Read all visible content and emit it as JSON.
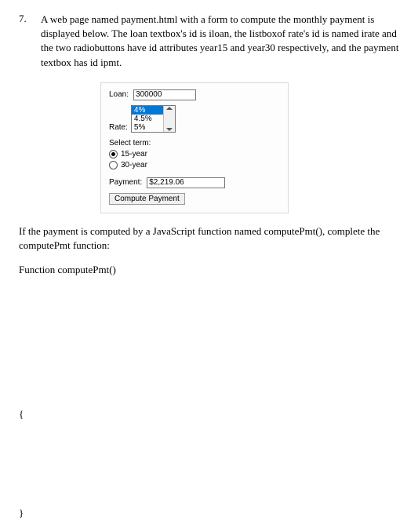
{
  "question": {
    "number": "7.",
    "text": "A web page named payment.html with a form to compute the monthly payment is displayed below.  The loan textbox's id is iloan, the listboxof rate's id is named irate and the two radiobuttons have id attributes year15 and year30 respectively, and the payment textbox has id ipmt."
  },
  "form": {
    "loan_label": "Loan:",
    "loan_value": "300000",
    "rate_label": "Rate:",
    "rate_options": [
      "4%",
      "4.5%",
      "5%"
    ],
    "select_term_label": "Select term:",
    "term15_label": "15-year",
    "term30_label": "30-year",
    "payment_label": "Payment:",
    "payment_value": "$2,219.06",
    "button_label": "Compute Payment"
  },
  "follow_text": "If the payment is computed by a JavaScript function named computePmt(), complete the computePmt function:",
  "fn_header": "Function computePmt()",
  "brace_open": "{",
  "brace_close": "}"
}
